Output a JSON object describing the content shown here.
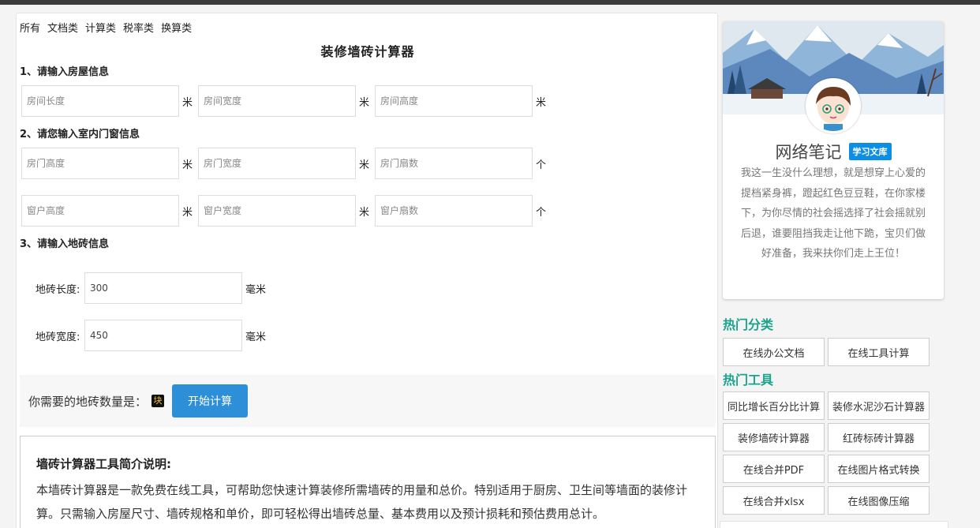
{
  "categories": [
    "所有",
    "文档类",
    "计算类",
    "税率类",
    "换算类"
  ],
  "page_title": "装修墙砖计算器",
  "sections": {
    "room": "1、请输入房屋信息",
    "doors_windows": "2、请您输入室内门窗信息",
    "tile": "3、请输入地砖信息"
  },
  "room_fields": [
    {
      "placeholder": "房间长度",
      "unit": "米"
    },
    {
      "placeholder": "房间宽度",
      "unit": "米"
    },
    {
      "placeholder": "房间高度",
      "unit": "米"
    }
  ],
  "door_fields": [
    {
      "placeholder": "房门高度",
      "unit": "米"
    },
    {
      "placeholder": "房门宽度",
      "unit": "米"
    },
    {
      "placeholder": "房门扇数",
      "unit": "个"
    }
  ],
  "window_fields": [
    {
      "placeholder": "窗户高度",
      "unit": "米"
    },
    {
      "placeholder": "窗户宽度",
      "unit": "米"
    },
    {
      "placeholder": "窗户扇数",
      "unit": "个"
    }
  ],
  "tile_fields": [
    {
      "label": "地砖长度:",
      "value": "300",
      "unit": "毫米"
    },
    {
      "label": "地砖宽度:",
      "value": "450",
      "unit": "毫米"
    }
  ],
  "result": {
    "text": "你需要的地砖数量是：",
    "unit_badge": "块",
    "button": "开始计算"
  },
  "intro": {
    "heading": "墙砖计算器工具简介说明:",
    "body": "本墙砖计算器是一款免费在线工具，可帮助您快速计算装修所需墙砖的用量和总价。特别适用于厨房、卫生间等墙面的装修计算。只需输入房屋尺寸、墙砖规格和单价，即可轻松得出墙砖总量、基本费用以及预计损耗和预估费用总计。"
  },
  "profile": {
    "name": "网络笔记",
    "tag": "学习文库",
    "bio": "我这一生没什么理想，就是想穿上心爱的提档紧身裤，蹬起红色豆豆鞋，在你家楼下，为你尽情的社会摇选择了社会摇就别后退，谁要阻挡我走让他下跪，宝贝们做好准备，我来扶你们走上王位！"
  },
  "hot_categories": {
    "heading": "热门分类",
    "items": [
      "在线办公文档",
      "在线工具计算"
    ]
  },
  "hot_tools": {
    "heading": "热门工具",
    "items": [
      "同比增长百分比计算",
      "装修水泥沙石计算器",
      "装修墙砖计算器",
      "红砖标砖计算器",
      "在线合并PDF",
      "在线图片格式转换",
      "在线合并xlsx",
      "在线图像压缩"
    ]
  },
  "colors": {
    "accent_green": "#1aa38c",
    "button_blue": "#2d8fd8",
    "tag_blue": "#0c8ee5"
  }
}
